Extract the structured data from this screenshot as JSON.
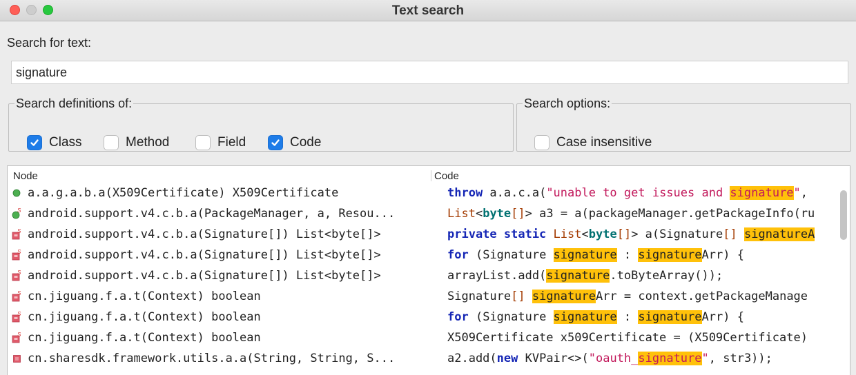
{
  "window": {
    "title": "Text search"
  },
  "search": {
    "label": "Search for text:",
    "value": "signature"
  },
  "definitions": {
    "legend": "Search definitions of:",
    "class": {
      "label": "Class",
      "checked": true
    },
    "method": {
      "label": "Method",
      "checked": false
    },
    "field": {
      "label": "Field",
      "checked": false
    },
    "code": {
      "label": "Code",
      "checked": true
    }
  },
  "options": {
    "legend": "Search options:",
    "case_insensitive": {
      "label": "Case insensitive",
      "checked": false
    }
  },
  "results": {
    "columns": {
      "node": "Node",
      "code": "Code"
    },
    "rows": [
      {
        "icon": "green-circle-icon",
        "node": "a.a.g.a.b.a(X509Certificate) X509Certificate",
        "code": [
          {
            "t": "throw",
            "c": "kw"
          },
          {
            "t": " a.a.c.a("
          },
          {
            "t": "\"unable to get issues and ",
            "c": "str"
          },
          {
            "t": "signature",
            "c": "str hl"
          },
          {
            "t": "\"",
            "c": "str"
          },
          {
            "t": ","
          }
        ]
      },
      {
        "icon": "static-method-icon",
        "node": "android.support.v4.c.b.a(PackageManager, a, Resou...",
        "code": [
          {
            "t": "List",
            "c": "tp"
          },
          {
            "t": "<"
          },
          {
            "t": "byte",
            "c": "kt"
          },
          {
            "t": "[]",
            "c": "tp"
          },
          {
            "t": "> a3 = a(packageManager.getPackageInfo("
          },
          {
            "t": "ru"
          }
        ]
      },
      {
        "icon": "static-private-method-icon",
        "node": "android.support.v4.c.b.a(Signature[]) List<byte[]>",
        "code": [
          {
            "t": "private static",
            "c": "kw"
          },
          {
            "t": " "
          },
          {
            "t": "List",
            "c": "tp"
          },
          {
            "t": "<"
          },
          {
            "t": "byte",
            "c": "kt"
          },
          {
            "t": "[]",
            "c": "tp"
          },
          {
            "t": "> a(Signature"
          },
          {
            "t": "[]",
            "c": "tp"
          },
          {
            "t": " "
          },
          {
            "t": "signatureA",
            "c": "hl"
          }
        ]
      },
      {
        "icon": "static-private-method-icon",
        "node": "android.support.v4.c.b.a(Signature[]) List<byte[]>",
        "code": [
          {
            "t": "for",
            "c": "kw"
          },
          {
            "t": " (Signature "
          },
          {
            "t": "signature",
            "c": "hl"
          },
          {
            "t": " : "
          },
          {
            "t": "signature",
            "c": "hl"
          },
          {
            "t": "Arr) {"
          }
        ]
      },
      {
        "icon": "static-private-method-icon",
        "node": "android.support.v4.c.b.a(Signature[]) List<byte[]>",
        "code": [
          {
            "t": "arrayList.add("
          },
          {
            "t": "signature",
            "c": "hl"
          },
          {
            "t": ".toByteArray());"
          }
        ]
      },
      {
        "icon": "static-private-method-icon",
        "node": "cn.jiguang.f.a.t(Context) boolean",
        "code": [
          {
            "t": "Signature"
          },
          {
            "t": "[]",
            "c": "tp"
          },
          {
            "t": " "
          },
          {
            "t": "signature",
            "c": "hl"
          },
          {
            "t": "Arr = context.getPackageManage"
          }
        ]
      },
      {
        "icon": "static-private-method-icon",
        "node": "cn.jiguang.f.a.t(Context) boolean",
        "code": [
          {
            "t": "for",
            "c": "kw"
          },
          {
            "t": " (Signature "
          },
          {
            "t": "signature",
            "c": "hl"
          },
          {
            "t": " : "
          },
          {
            "t": "signature",
            "c": "hl"
          },
          {
            "t": "Arr) {"
          }
        ]
      },
      {
        "icon": "static-private-method-icon",
        "node": "cn.jiguang.f.a.t(Context) boolean",
        "code": [
          {
            "t": "X509Certificate x509Certificate = (X509Certificate)"
          }
        ]
      },
      {
        "icon": "red-square-icon",
        "node": "cn.sharesdk.framework.utils.a.a(String, String, S...",
        "code": [
          {
            "t": "a2.add("
          },
          {
            "t": "new",
            "c": "kw"
          },
          {
            "t": " KVPair<>("
          },
          {
            "t": "\"oauth_",
            "c": "str"
          },
          {
            "t": "signature",
            "c": "str hl"
          },
          {
            "t": "\"",
            "c": "str"
          },
          {
            "t": ", str3));"
          }
        ]
      }
    ]
  },
  "colors": {
    "accent": "#1e7ce8",
    "highlight": "#ffc10a",
    "keyword": "#1526b5",
    "string": "#c2185b"
  }
}
